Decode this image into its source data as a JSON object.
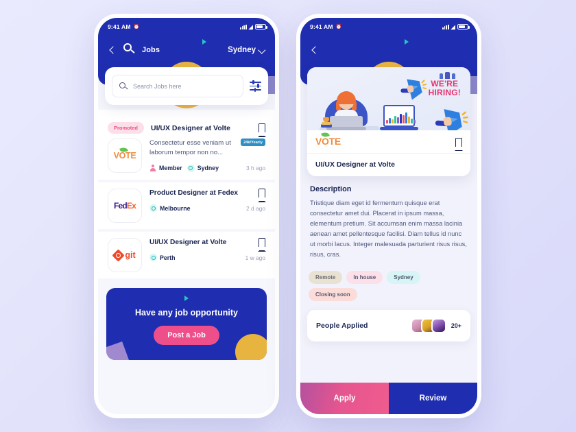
{
  "status_bar": {
    "time": "9:41 AM",
    "alarm_icon": "alarm-icon",
    "signal_icon": "signal-bars-icon",
    "wifi_icon": "wifi-icon",
    "battery_icon": "battery-icon"
  },
  "left_screen": {
    "nav": {
      "back_icon": "chevron-left-icon",
      "brand_icon": "search-logo-icon",
      "title": "Jobs",
      "location": "Sydney",
      "location_chevron": "chevron-down-icon"
    },
    "search": {
      "icon": "search-icon",
      "placeholder": "Search Jobs here",
      "value": "",
      "filter_icon": "filter-sliders-icon"
    },
    "promoted": {
      "badge": "Promoted",
      "title": "UI/UX Designer at Volte",
      "bookmark_icon": "bookmark-icon"
    },
    "jobs": [
      {
        "logo": "VOTE",
        "logo_name": "vote-logo",
        "description": "Consectetur esse veniam ut laborum tempor non no...",
        "pay_badge": "24k/Yearly",
        "meta_member": "Member",
        "meta_location": "Sydney",
        "time_ago": "3 h ago",
        "has_bookmark": false
      },
      {
        "logo": "FedEx",
        "logo_name": "fedex-logo",
        "title": "Product Designer at Fedex",
        "meta_location": "Melbourne",
        "time_ago": "2 d ago",
        "has_bookmark": true
      },
      {
        "logo": "git",
        "logo_name": "git-logo",
        "title": "UI/UX Designer at Volte",
        "meta_location": "Perth",
        "time_ago": "1 w ago",
        "has_bookmark": true
      }
    ],
    "cta": {
      "title": "Have any job opportunity",
      "button": "Post a Job"
    }
  },
  "right_screen": {
    "nav": {
      "back_icon": "chevron-left-icon"
    },
    "hero": {
      "banner_text_line1": "WE'RE",
      "banner_text_line2": "HIRING!",
      "illustration_name": "hiring-illustration",
      "logo": "VOTE",
      "bookmark_icon": "bookmark-icon",
      "job_title": "UI/UX Designer at Volte"
    },
    "description": {
      "heading": "Description",
      "body": "Tristique diam eget id fermentum quisque erat consectetur amet dui. Placerat in ipsum massa, elementum pretium. Sit accumsan enim massa lacinia aenean amet pellentesque facilisi. Diam tellus id nunc ut morbi lacus. Integer malesuada parturient risus risus, risus, cras."
    },
    "tags": [
      {
        "label": "Remote",
        "bg": "#e9e2d2",
        "fg": "#6a6a78"
      },
      {
        "label": "In house",
        "bg": "#fbdfe9",
        "fg": "#5a5a70"
      },
      {
        "label": "Sydney",
        "bg": "#d8f4f4",
        "fg": "#4a5a70"
      },
      {
        "label": "Closing soon",
        "bg": "#fbdcd9",
        "fg": "#5a5a70"
      }
    ],
    "applied": {
      "label": "People Applied",
      "count": "20+",
      "avatar_names": [
        "avatar-1",
        "avatar-2",
        "avatar-3"
      ]
    },
    "actions": {
      "apply": "Apply",
      "review": "Review"
    }
  },
  "theme": {
    "primary_blue": "#1f2db0",
    "pink": "#ee4f8b",
    "teal": "#24c6c6",
    "yellow": "#e8b440",
    "purple": "#8a86c9",
    "badge_blue": "#2e8fc4"
  },
  "chart_bars": [
    {
      "h": 5,
      "c": "#e8536d"
    },
    {
      "h": 8,
      "c": "#2f7fe0"
    },
    {
      "h": 6,
      "c": "#f0b429"
    },
    {
      "h": 11,
      "c": "#2ec4a5"
    },
    {
      "h": 9,
      "c": "#8a5fd0"
    },
    {
      "h": 14,
      "c": "#2a3bb8"
    },
    {
      "h": 12,
      "c": "#e8536d"
    },
    {
      "h": 16,
      "c": "#2f7fe0"
    },
    {
      "h": 10,
      "c": "#f0b429"
    },
    {
      "h": 7,
      "c": "#2ec4a5"
    },
    {
      "h": 5,
      "c": "#8a5fd0"
    }
  ]
}
